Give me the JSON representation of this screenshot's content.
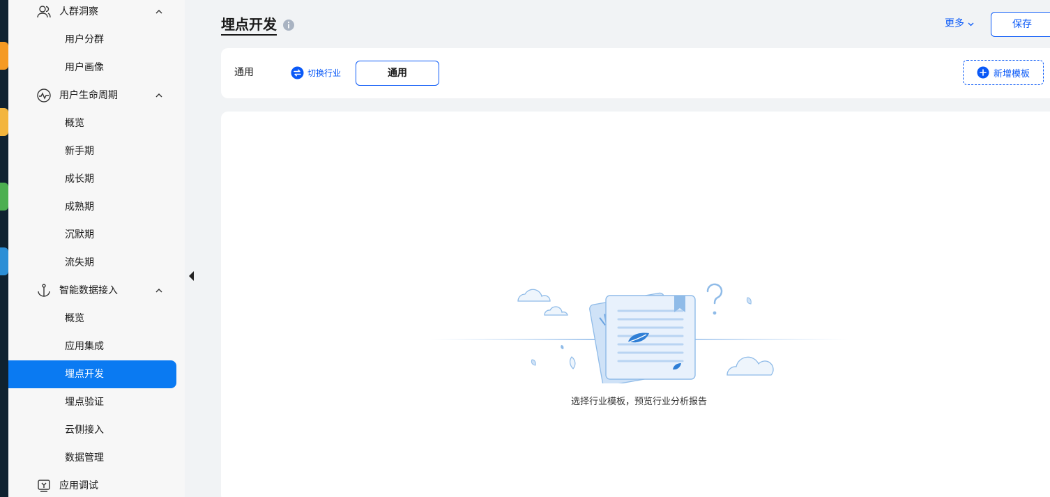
{
  "sidebar": {
    "groups": [
      {
        "label": "人群洞察",
        "items": [
          "用户分群",
          "用户画像"
        ]
      },
      {
        "label": "用户生命周期",
        "items": [
          "概览",
          "新手期",
          "成长期",
          "成熟期",
          "沉默期",
          "流失期"
        ]
      },
      {
        "label": "智能数据接入",
        "items": [
          "概览",
          "应用集成",
          "埋点开发",
          "埋点验证",
          "云侧接入",
          "数据管理"
        ]
      },
      {
        "label": "应用调试",
        "items": []
      }
    ],
    "active_item": "埋点开发"
  },
  "header": {
    "title": "埋点开发",
    "more_label": "更多",
    "save_label": "保存"
  },
  "template_bar": {
    "label": "通用",
    "switch_label": "切换行业",
    "selected_template": "通用",
    "add_label": "新增模板"
  },
  "empty_state": {
    "message": "选择行业模板，预览行业分析报告"
  },
  "colors": {
    "accent": "#0a59f7",
    "active_bg": "#0a7af2",
    "sidebar_bg": "#f7f7f7",
    "page_bg": "#f1f3f5"
  },
  "icons": {
    "group_1": "people-icon",
    "group_2": "pulse-icon",
    "group_3": "anchor-icon",
    "group_4": "debug-icon"
  }
}
